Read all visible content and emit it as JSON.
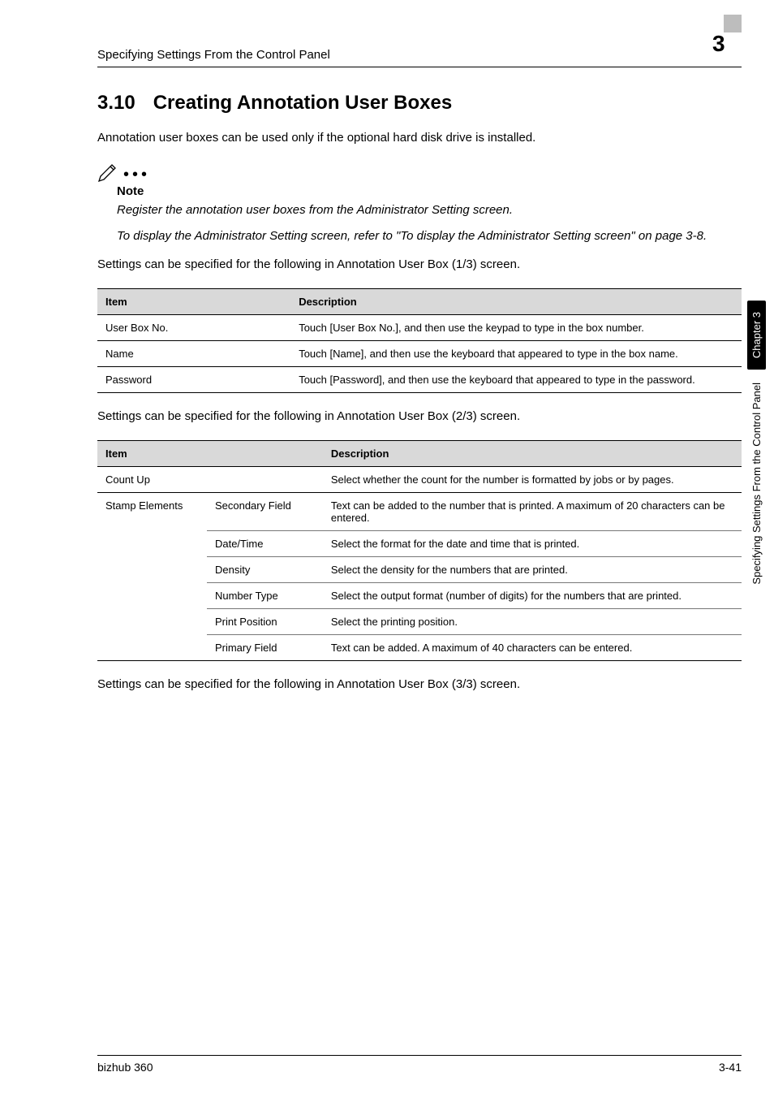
{
  "header": {
    "running_title": "Specifying Settings From the Control Panel",
    "chapter_number": "3"
  },
  "section": {
    "number": "3.10",
    "title": "Creating Annotation User Boxes",
    "intro": "Annotation user boxes can be used only if the optional hard disk drive is installed."
  },
  "note": {
    "label": "Note",
    "p1": "Register the annotation user boxes from the Administrator Setting screen.",
    "p2": "To display the Administrator Setting screen, refer to \"To display the Administrator Setting screen\" on page 3-8."
  },
  "t1_intro": "Settings can be specified for the following in Annotation User Box (1/3) screen.",
  "t1": {
    "h_item": "Item",
    "h_desc": "Description",
    "r1_item": "User Box No.",
    "r1_desc": "Touch [User Box No.], and then use the keypad to type in the box number.",
    "r2_item": "Name",
    "r2_desc": "Touch [Name], and then use the keyboard that appeared to type in the box name.",
    "r3_item": "Password",
    "r3_desc": "Touch [Password], and then use the keyboard that appeared to type in the password."
  },
  "t2_intro": "Settings can be specified for the following in Annotation User Box (2/3) screen.",
  "t2": {
    "h_item": "Item",
    "h_desc": "Description",
    "r1_item": "Count Up",
    "r1_desc": "Select whether the count for the number is formatted by jobs or by pages.",
    "group_label": "Stamp Elements",
    "r2_sub": "Secondary Field",
    "r2_desc": "Text can be added to the number that is printed. A maximum of 20 characters can be entered.",
    "r3_sub": "Date/Time",
    "r3_desc": "Select the format for the date and time that is printed.",
    "r4_sub": "Density",
    "r4_desc": "Select the density for the numbers that are printed.",
    "r5_sub": "Number Type",
    "r5_desc": "Select the output format (number of digits) for the numbers that are printed.",
    "r6_sub": "Print Position",
    "r6_desc": "Select the printing position.",
    "r7_sub": "Primary Field",
    "r7_desc": "Text can be added. A maximum of 40 characters can be entered."
  },
  "t3_intro": "Settings can be specified for the following in Annotation User Box (3/3) screen.",
  "side": {
    "tab_dark": "Chapter 3",
    "tab_light": "Specifying Settings From the Control Panel"
  },
  "footer": {
    "left": "bizhub 360",
    "right": "3-41"
  }
}
